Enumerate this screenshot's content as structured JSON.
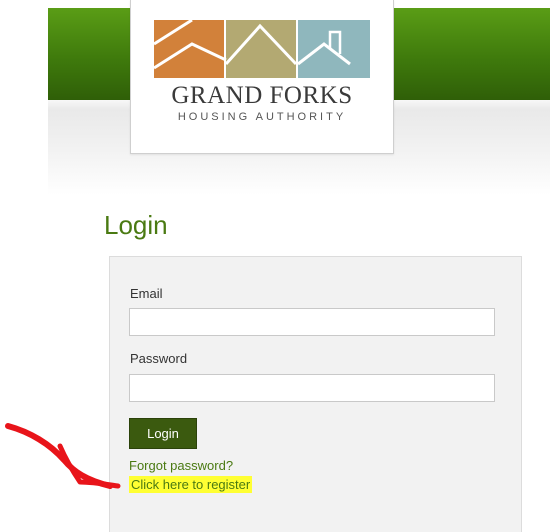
{
  "brand": {
    "name": "GRAND FORKS",
    "subtitle": "HOUSING AUTHORITY",
    "colors": {
      "orange": "#d2813a",
      "olive": "#b3a972",
      "teal": "#8fb7bd",
      "green": "#3f7a0c"
    }
  },
  "page": {
    "title": "Login"
  },
  "form": {
    "email_label": "Email",
    "email_value": "",
    "password_label": "Password",
    "password_value": "",
    "login_label": "Login",
    "forgot_label": "Forgot password?",
    "register_label": "Click here to register"
  },
  "annotation": {
    "arrow_color": "#e8141a",
    "highlight_color": "#ffff33"
  }
}
